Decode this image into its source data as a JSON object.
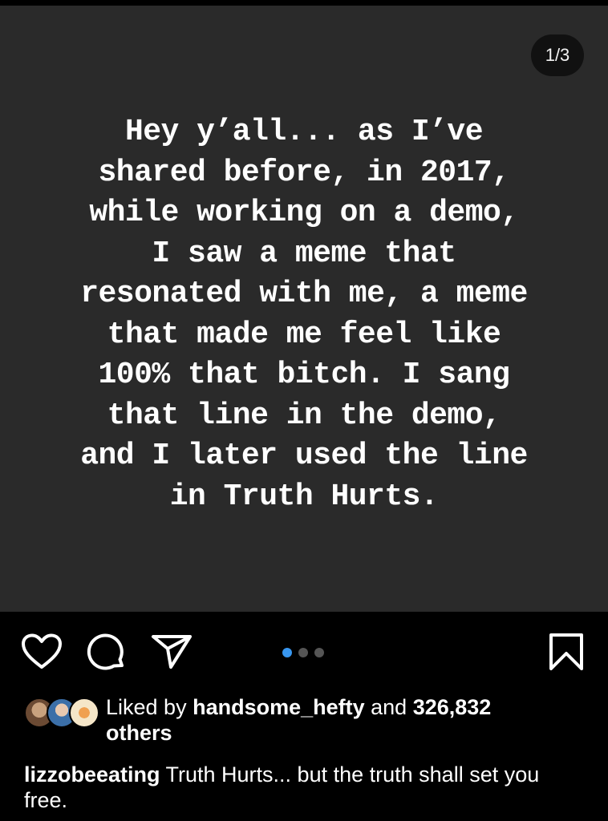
{
  "post": {
    "page_counter": "1/3",
    "story_text": "Hey y’all... as I’ve\nshared before, in 2017,\nwhile working on a demo,\nI saw a meme that\nresonated with me, a meme\nthat made me feel like\n100% that bitch. I sang\nthat line in the demo,\nand I later used the line\nin Truth Hurts.",
    "carousel": {
      "total": 3,
      "active_index": 0
    }
  },
  "actions": {
    "like_icon": "heart-outline-icon",
    "comment_icon": "speech-bubble-icon",
    "share_icon": "paper-plane-icon",
    "save_icon": "bookmark-icon"
  },
  "likes": {
    "prefix": "Liked by ",
    "user": "handsome_hefty",
    "middle": " and ",
    "count": "326,832",
    "suffix": "others"
  },
  "caption": {
    "username": "lizzobeeating",
    "text": " Truth Hurts... but the truth shall set you free."
  },
  "colors": {
    "background": "#000000",
    "media_background": "#2a2a2a",
    "active_dot": "#3897f0",
    "inactive_dot": "#555555"
  }
}
